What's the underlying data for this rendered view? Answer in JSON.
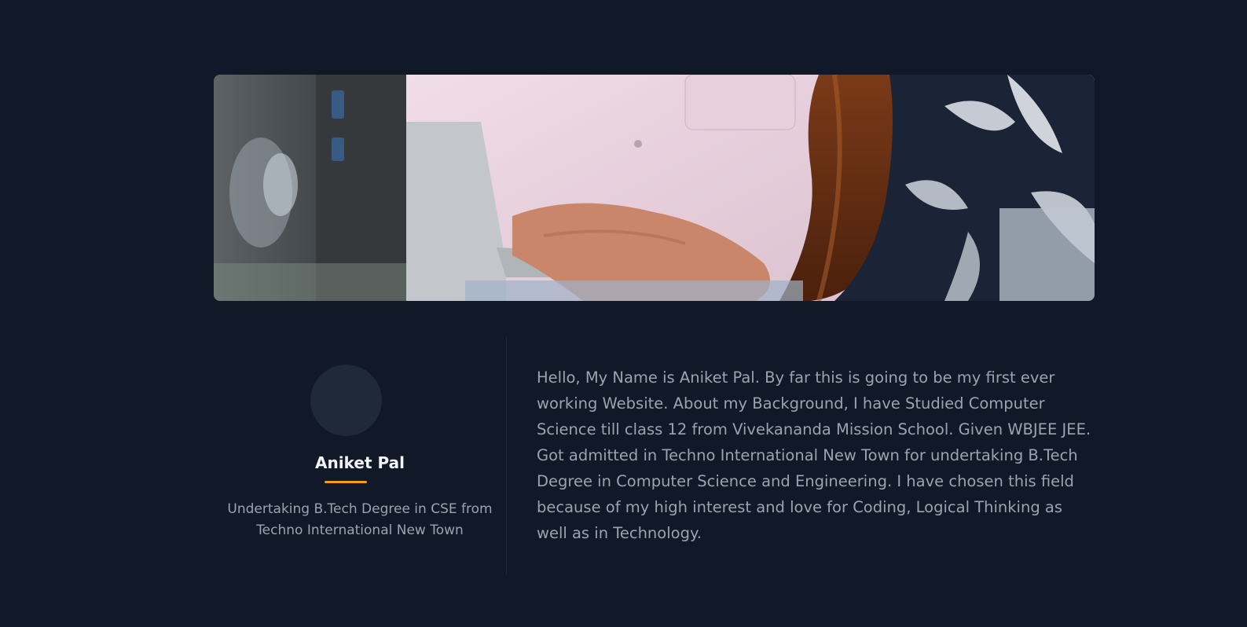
{
  "profile": {
    "name": "Aniket Pal",
    "tagline": "Undertaking B.Tech Degree in CSE from Techno International New Town",
    "accent_color": "#f59e0b"
  },
  "about": {
    "text": "Hello, My Name is Aniket Pal. By far this is going to be my first ever working Website. About my Background, I have Studied Computer Science till class 12 from Vivekananda Mission School. Given WBJEE JEE. Got admitted in Techno International New Town for undertaking B.Tech Degree in Computer Science and Engineering. I have chosen this field because of my high interest and love for Coding, Logical Thinking as well as in Technology."
  },
  "theme": {
    "background": "#111827",
    "divider": "#1f2937",
    "muted_text": "#9ca3af"
  }
}
